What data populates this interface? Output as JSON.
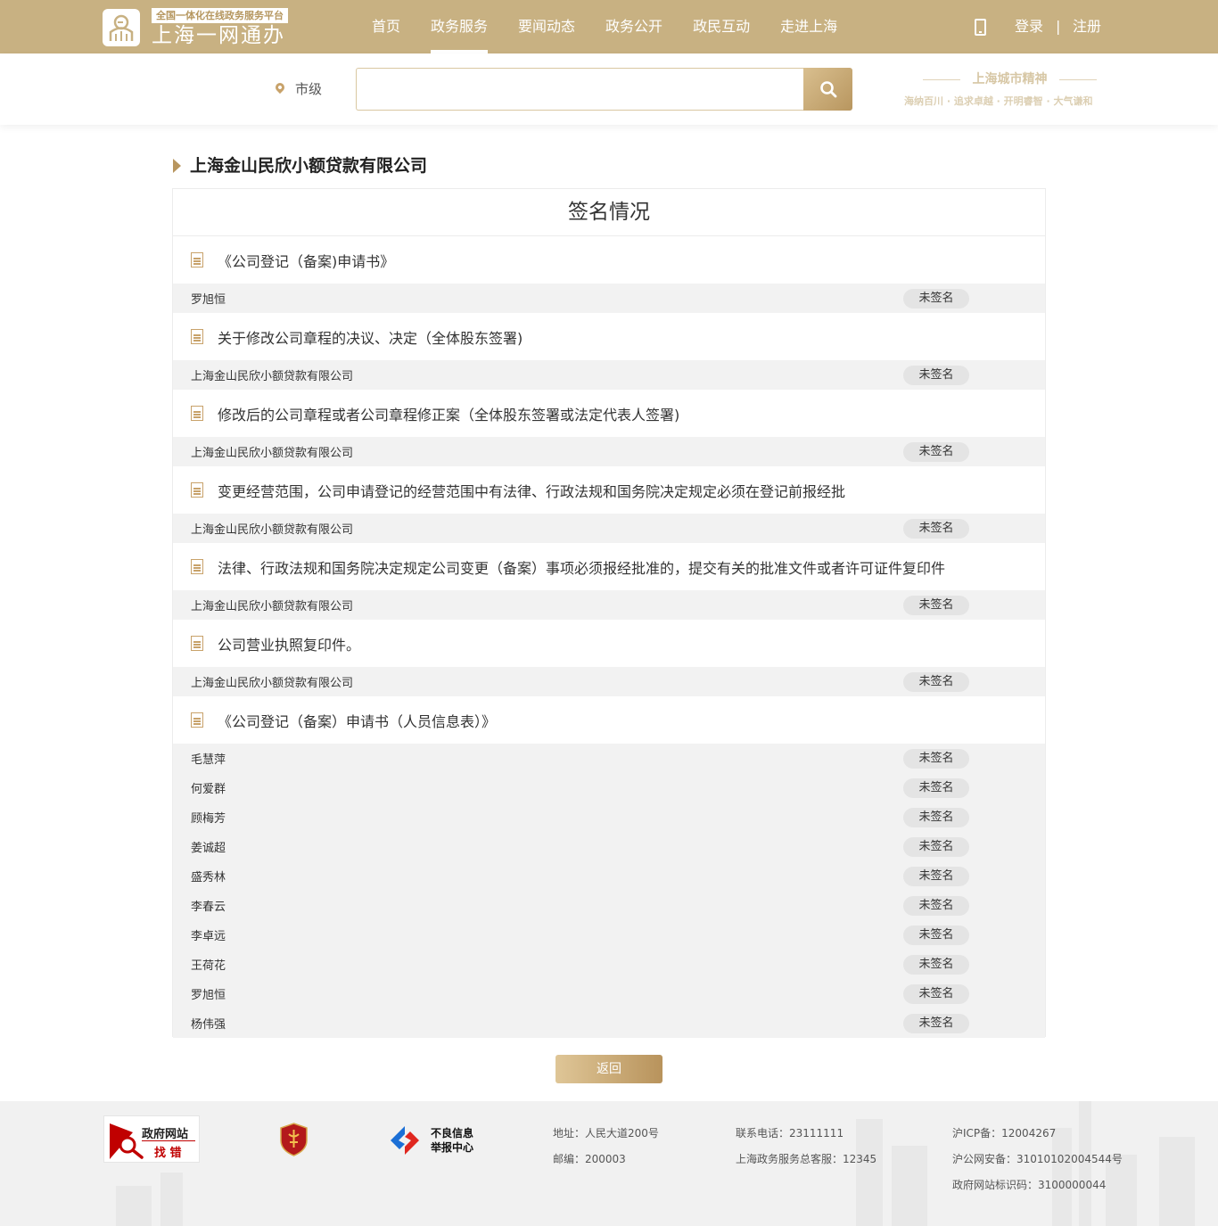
{
  "header": {
    "logo_tag": "全国一体化在线政务服务平台",
    "logo_name": "上海一网通办",
    "nav": [
      {
        "label": "首页",
        "active": false
      },
      {
        "label": "政务服务",
        "active": true
      },
      {
        "label": "要闻动态",
        "active": false
      },
      {
        "label": "政务公开",
        "active": false
      },
      {
        "label": "政民互动",
        "active": false
      },
      {
        "label": "走进上海",
        "active": false
      }
    ],
    "login": "登录",
    "separator": "|",
    "register": "注册"
  },
  "search": {
    "location": "市级",
    "value": "",
    "slogan_title": "上海城市精神",
    "slogan_sub": "海纳百川 · 追求卓越 · 开明睿智 · 大气谦和"
  },
  "main": {
    "company": "上海金山民欣小额贷款有限公司",
    "panel_title": "签名情况",
    "documents": [
      {
        "title": "《公司登记（备案)申请书》",
        "signers": [
          {
            "name": "罗旭恒",
            "status": "未签名"
          }
        ]
      },
      {
        "title": "关于修改公司章程的决议、决定（全体股东签署)",
        "signers": [
          {
            "name": "上海金山民欣小额贷款有限公司",
            "status": "未签名"
          }
        ]
      },
      {
        "title": "修改后的公司章程或者公司章程修正案（全体股东签署或法定代表人签署)",
        "signers": [
          {
            "name": "上海金山民欣小额贷款有限公司",
            "status": "未签名"
          }
        ]
      },
      {
        "title": "变更经营范围，公司申请登记的经营范围中有法律、行政法规和国务院决定规定必须在登记前报经批",
        "signers": [
          {
            "name": "上海金山民欣小额贷款有限公司",
            "status": "未签名"
          }
        ]
      },
      {
        "title": "法律、行政法规和国务院决定规定公司变更（备案）事项必须报经批准的，提交有关的批准文件或者许可证件复印件",
        "signers": [
          {
            "name": "上海金山民欣小额贷款有限公司",
            "status": "未签名"
          }
        ]
      },
      {
        "title": "公司营业执照复印件。",
        "signers": [
          {
            "name": "上海金山民欣小额贷款有限公司",
            "status": "未签名"
          }
        ]
      },
      {
        "title": "《公司登记（备案）申请书（人员信息表）》",
        "signers": [
          {
            "name": "毛慧萍",
            "status": "未签名"
          },
          {
            "name": "何爱群",
            "status": "未签名"
          },
          {
            "name": "顾梅芳",
            "status": "未签名"
          },
          {
            "name": "姜诚超",
            "status": "未签名"
          },
          {
            "name": "盛秀林",
            "status": "未签名"
          },
          {
            "name": "李春云",
            "status": "未签名"
          },
          {
            "name": "李卓远",
            "status": "未签名"
          },
          {
            "name": "王荷花",
            "status": "未签名"
          },
          {
            "name": "罗旭恒",
            "status": "未签名"
          },
          {
            "name": "杨伟强",
            "status": "未签名"
          }
        ]
      }
    ],
    "back_label": "返回"
  },
  "footer": {
    "badge_zfwz_top": "政府网站",
    "badge_zfwz_bottom": "找 错",
    "badge_report_line1": "不良信息",
    "badge_report_line2": "举报中心",
    "address": "地址：人民大道200号",
    "postcode": "邮编：200003",
    "phone": "联系电话：23111111",
    "hotline": "上海政务服务总客服：12345",
    "icp": "沪ICP备：12004267",
    "police": "沪公网安备：31010102004544号",
    "site_code": "政府网站标识码：3100000044"
  },
  "colors": {
    "brand": "#c8b182",
    "accent": "#b8965f",
    "zfwz_red": "#c00000"
  }
}
